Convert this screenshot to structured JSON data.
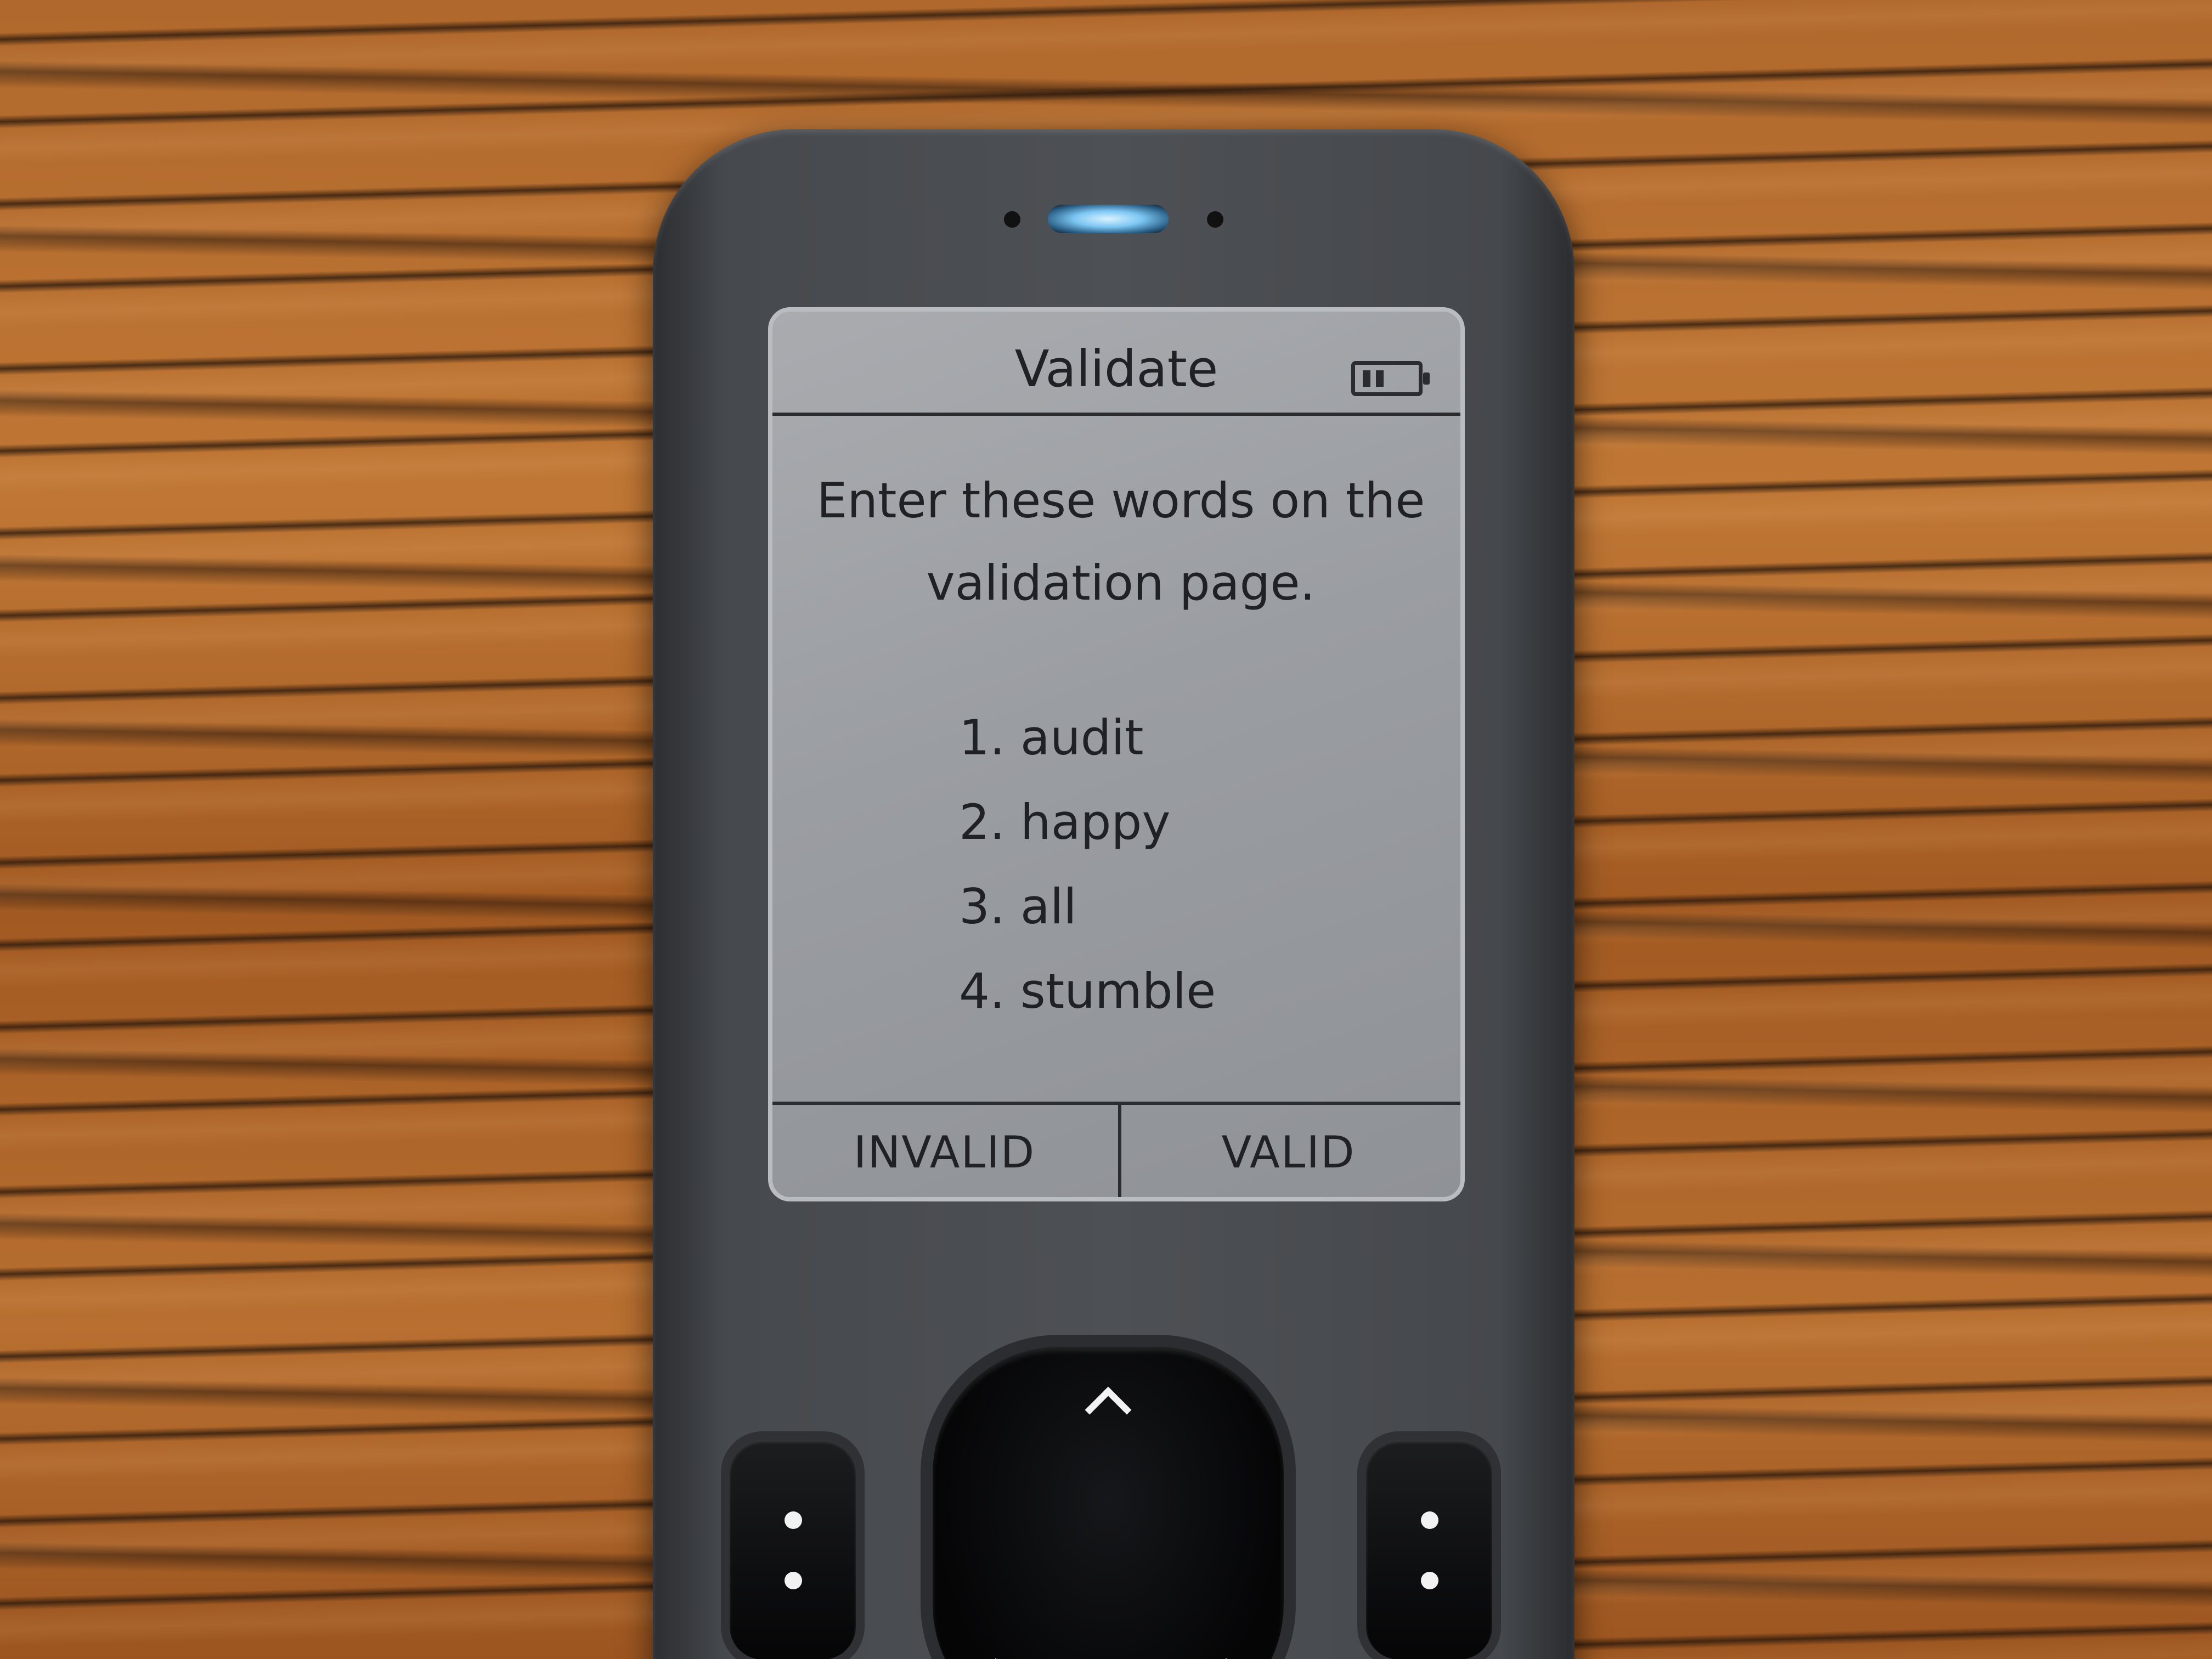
{
  "screen": {
    "title": "Validate",
    "instruction": "Enter these words on the validation page.",
    "words": [
      "1. audit",
      "2. happy",
      "3. all",
      "4. stumble"
    ],
    "softkeys": {
      "left": "INVALID",
      "right": "VALID"
    }
  },
  "icons": {
    "battery": "battery-icon",
    "dpad_up": "chevron-up-icon",
    "dpad_left": "chevron-left-icon",
    "dpad_right": "chevron-right-icon",
    "side_keys": "two-dot-icon"
  },
  "colors": {
    "screen_background": "#9a9da2",
    "screen_text": "#1f2124",
    "device_body": "#4d5054",
    "led": "#7cc6f3",
    "table_wood": "#b0682c"
  }
}
